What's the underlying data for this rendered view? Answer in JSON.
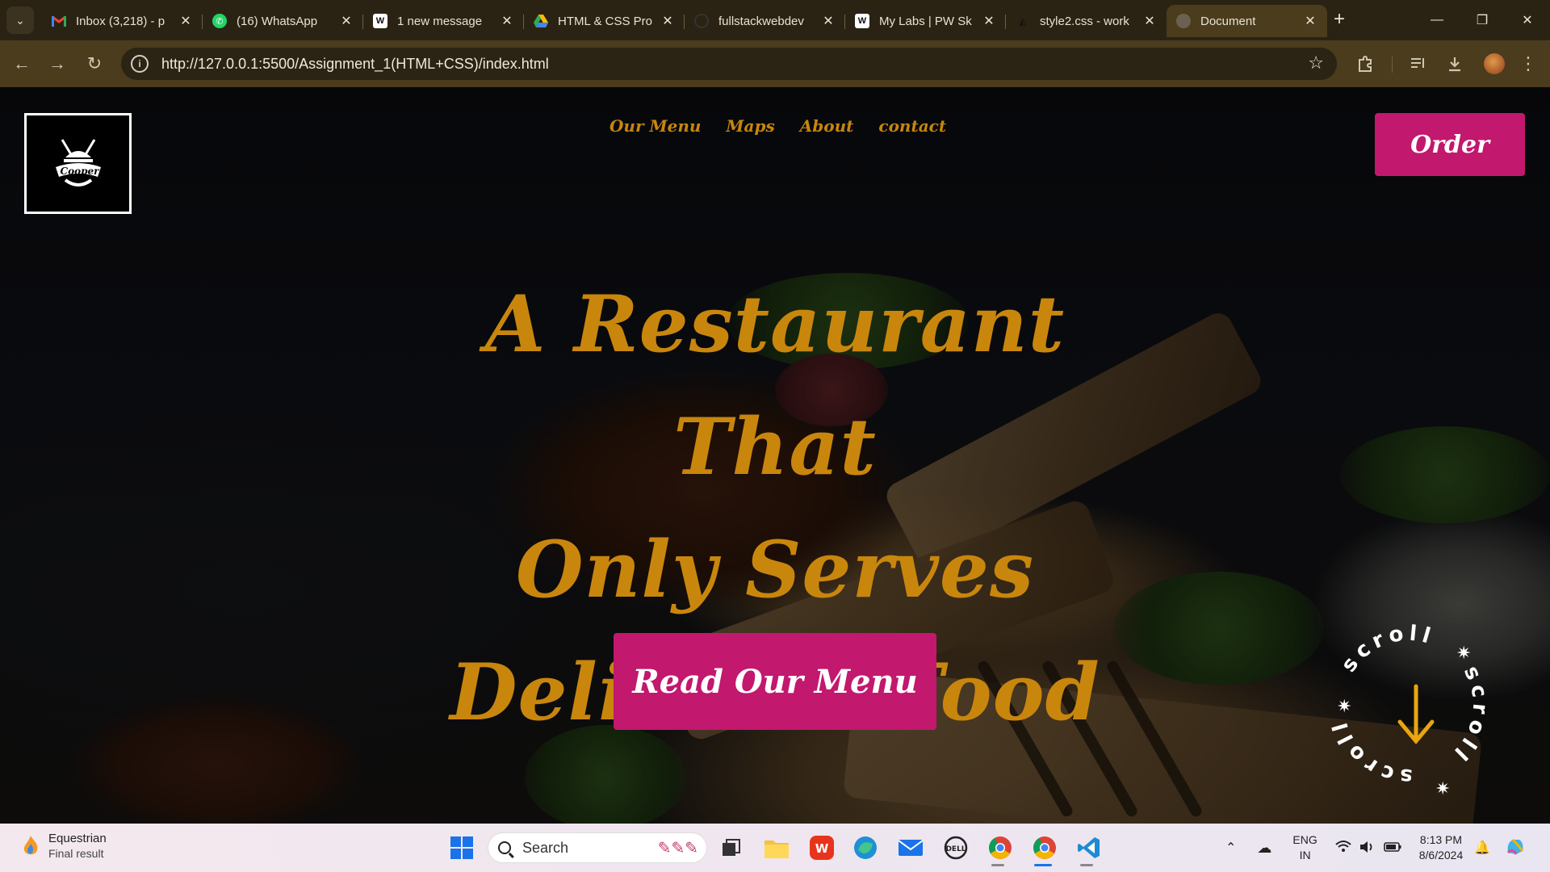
{
  "browser": {
    "tabs": [
      {
        "title": "Inbox (3,218) - p",
        "favicon": "gmail-icon"
      },
      {
        "title": "(16) WhatsApp",
        "favicon": "whatsapp-icon"
      },
      {
        "title": "1 new message",
        "favicon": "pwskills-icon"
      },
      {
        "title": "HTML & CSS Pro",
        "favicon": "google-drive-icon"
      },
      {
        "title": "fullstackwebdev",
        "favicon": "github-icon"
      },
      {
        "title": "My Labs | PW Sk",
        "favicon": "pwskills-icon"
      },
      {
        "title": "style2.css - work",
        "favicon": "codesandbox-icon"
      },
      {
        "title": "Document",
        "favicon": "globe-icon",
        "active": true
      }
    ],
    "url": "http://127.0.0.1:5500/Assignment_1(HTML+CSS)/index.html"
  },
  "page": {
    "logo_text": "Cooper",
    "nav": [
      "Our Menu",
      "Maps",
      "About",
      "contact"
    ],
    "order_label": "Order",
    "headline": [
      "A Restaurant That",
      "Only Serves",
      "Delicious Food"
    ],
    "cta_label": "Read Our Menu",
    "scroll_badge_text": "scroll",
    "colors": {
      "accent_gold": "#c9860d",
      "button_magenta": "#c2186e"
    }
  },
  "taskbar": {
    "widget": {
      "title": "Equestrian",
      "subtitle": "Final result"
    },
    "search_placeholder": "Search",
    "language": {
      "line1": "ENG",
      "line2": "IN"
    },
    "clock": {
      "time": "8:13 PM",
      "date": "8/6/2024"
    },
    "pinned": [
      "file-explorer-icon",
      "wps-office-icon",
      "edge-icon",
      "mail-icon",
      "dell-icon",
      "chrome-icon",
      "chrome-icon",
      "vscode-icon"
    ]
  }
}
